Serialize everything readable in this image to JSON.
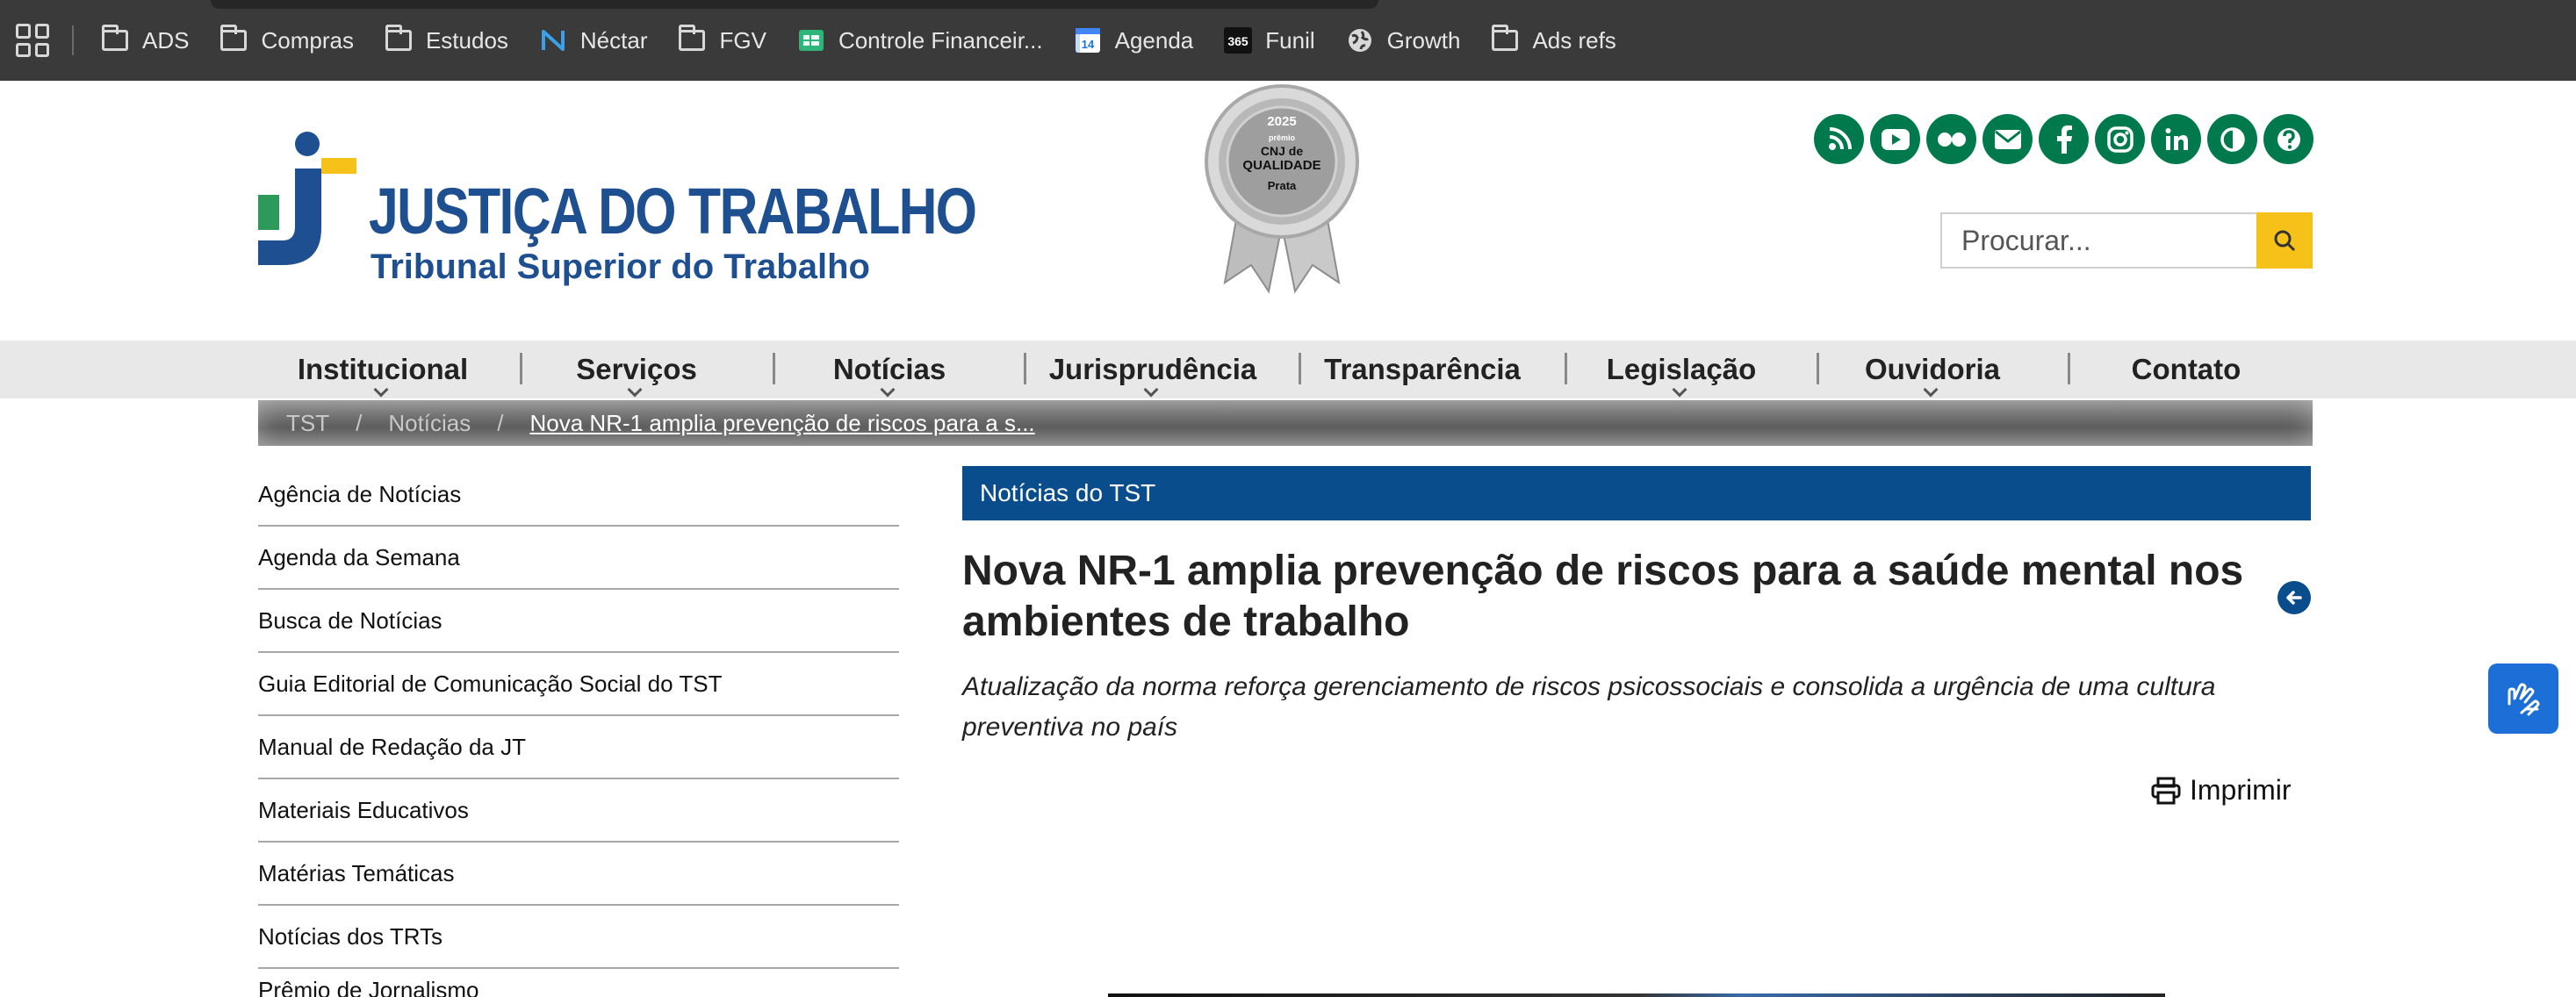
{
  "bookmarks": {
    "items": [
      {
        "label": "ADS",
        "icon": "folder-icon"
      },
      {
        "label": "Compras",
        "icon": "folder-icon"
      },
      {
        "label": "Estudos",
        "icon": "folder-icon"
      },
      {
        "label": "Néctar",
        "icon": "nectar-logo-icon"
      },
      {
        "label": "FGV",
        "icon": "folder-icon"
      },
      {
        "label": "Controle Financeir...",
        "icon": "sheets-icon"
      },
      {
        "label": "Agenda",
        "icon": "calendar-icon"
      },
      {
        "label": "Funil",
        "icon": "funil-365-icon"
      },
      {
        "label": "Growth",
        "icon": "globe-icon"
      },
      {
        "label": "Ads refs",
        "icon": "folder-icon"
      }
    ]
  },
  "header": {
    "logo_title": "JUSTIÇA DO TRABALHO",
    "logo_subtitle": "Tribunal Superior do Trabalho",
    "medal": {
      "year": "2025",
      "line1": "prêmio",
      "line2": "CNJ de",
      "line3": "QUALIDADE",
      "level": "Prata"
    },
    "social_icons": [
      "rss-icon",
      "youtube-icon",
      "flickr-icon",
      "email-icon",
      "facebook-icon",
      "instagram-icon",
      "linkedin-icon",
      "contrast-icon",
      "help-icon"
    ],
    "search_placeholder": "Procurar..."
  },
  "nav": {
    "items": [
      {
        "label": "Institucional",
        "dropdown": true
      },
      {
        "label": "Serviços",
        "dropdown": true
      },
      {
        "label": "Notícias",
        "dropdown": true
      },
      {
        "label": "Jurisprudência",
        "dropdown": true
      },
      {
        "label": "Transparência",
        "dropdown": false
      },
      {
        "label": "Legislação",
        "dropdown": true
      },
      {
        "label": "Ouvidoria",
        "dropdown": true
      },
      {
        "label": "Contato",
        "dropdown": false
      }
    ]
  },
  "breadcrumb": {
    "items": [
      "TST",
      "Notícias"
    ],
    "current": "Nova NR-1 amplia prevenção de riscos para a s..."
  },
  "sidebar": {
    "items": [
      "Agência de Notícias",
      "Agenda da Semana",
      "Busca de Notícias",
      "Guia Editorial de Comunicação Social do TST",
      "Manual de Redação da JT",
      "Materiais Educativos",
      "Matérias Temáticas",
      "Notícias dos TRTs",
      "Prêmio de Jornalismo"
    ]
  },
  "article": {
    "section": "Notícias do TST",
    "title": "Nova NR-1 amplia prevenção de riscos para a saúde mental nos ambientes de trabalho",
    "subtitle": "Atualização da norma reforça gerenciamento de riscos psicossociais e consolida a urgência de uma cultura preventiva no país",
    "print_label": "Imprimir"
  },
  "colors": {
    "brand_blue": "#0a4d8c",
    "social_green": "#007a4d",
    "search_yellow": "#f6c21a",
    "accessibility_blue": "#1b6fd6"
  }
}
